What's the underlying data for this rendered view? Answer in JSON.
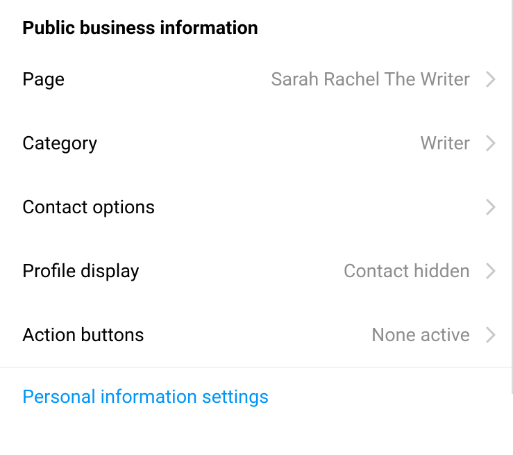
{
  "section": {
    "title": "Public business information",
    "rows": [
      {
        "label": "Page",
        "value": "Sarah Rachel The Writer"
      },
      {
        "label": "Category",
        "value": "Writer"
      },
      {
        "label": "Contact options",
        "value": ""
      },
      {
        "label": "Profile display",
        "value": "Contact hidden"
      },
      {
        "label": "Action buttons",
        "value": "None active"
      }
    ]
  },
  "link": {
    "label": "Personal information settings"
  }
}
